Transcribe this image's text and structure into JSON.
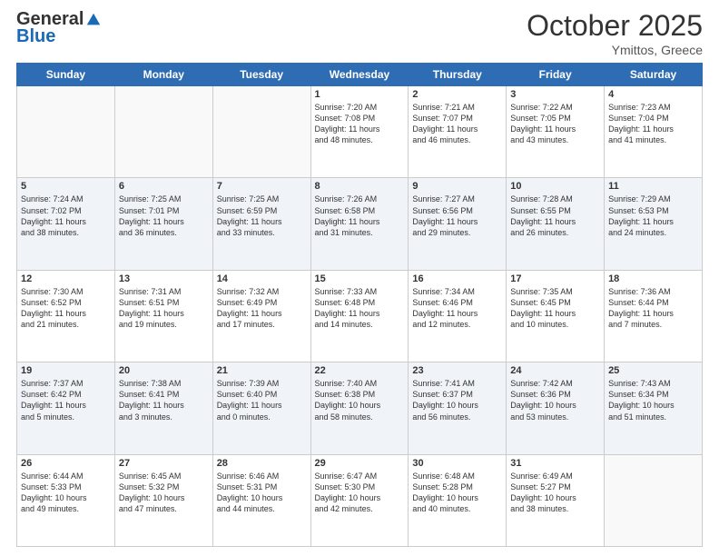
{
  "logo": {
    "general": "General",
    "blue": "Blue"
  },
  "header": {
    "month": "October 2025",
    "location": "Ymittos, Greece"
  },
  "days_of_week": [
    "Sunday",
    "Monday",
    "Tuesday",
    "Wednesday",
    "Thursday",
    "Friday",
    "Saturday"
  ],
  "weeks": [
    [
      {
        "day": "",
        "info": ""
      },
      {
        "day": "",
        "info": ""
      },
      {
        "day": "",
        "info": ""
      },
      {
        "day": "1",
        "info": "Sunrise: 7:20 AM\nSunset: 7:08 PM\nDaylight: 11 hours\nand 48 minutes."
      },
      {
        "day": "2",
        "info": "Sunrise: 7:21 AM\nSunset: 7:07 PM\nDaylight: 11 hours\nand 46 minutes."
      },
      {
        "day": "3",
        "info": "Sunrise: 7:22 AM\nSunset: 7:05 PM\nDaylight: 11 hours\nand 43 minutes."
      },
      {
        "day": "4",
        "info": "Sunrise: 7:23 AM\nSunset: 7:04 PM\nDaylight: 11 hours\nand 41 minutes."
      }
    ],
    [
      {
        "day": "5",
        "info": "Sunrise: 7:24 AM\nSunset: 7:02 PM\nDaylight: 11 hours\nand 38 minutes."
      },
      {
        "day": "6",
        "info": "Sunrise: 7:25 AM\nSunset: 7:01 PM\nDaylight: 11 hours\nand 36 minutes."
      },
      {
        "day": "7",
        "info": "Sunrise: 7:25 AM\nSunset: 6:59 PM\nDaylight: 11 hours\nand 33 minutes."
      },
      {
        "day": "8",
        "info": "Sunrise: 7:26 AM\nSunset: 6:58 PM\nDaylight: 11 hours\nand 31 minutes."
      },
      {
        "day": "9",
        "info": "Sunrise: 7:27 AM\nSunset: 6:56 PM\nDaylight: 11 hours\nand 29 minutes."
      },
      {
        "day": "10",
        "info": "Sunrise: 7:28 AM\nSunset: 6:55 PM\nDaylight: 11 hours\nand 26 minutes."
      },
      {
        "day": "11",
        "info": "Sunrise: 7:29 AM\nSunset: 6:53 PM\nDaylight: 11 hours\nand 24 minutes."
      }
    ],
    [
      {
        "day": "12",
        "info": "Sunrise: 7:30 AM\nSunset: 6:52 PM\nDaylight: 11 hours\nand 21 minutes."
      },
      {
        "day": "13",
        "info": "Sunrise: 7:31 AM\nSunset: 6:51 PM\nDaylight: 11 hours\nand 19 minutes."
      },
      {
        "day": "14",
        "info": "Sunrise: 7:32 AM\nSunset: 6:49 PM\nDaylight: 11 hours\nand 17 minutes."
      },
      {
        "day": "15",
        "info": "Sunrise: 7:33 AM\nSunset: 6:48 PM\nDaylight: 11 hours\nand 14 minutes."
      },
      {
        "day": "16",
        "info": "Sunrise: 7:34 AM\nSunset: 6:46 PM\nDaylight: 11 hours\nand 12 minutes."
      },
      {
        "day": "17",
        "info": "Sunrise: 7:35 AM\nSunset: 6:45 PM\nDaylight: 11 hours\nand 10 minutes."
      },
      {
        "day": "18",
        "info": "Sunrise: 7:36 AM\nSunset: 6:44 PM\nDaylight: 11 hours\nand 7 minutes."
      }
    ],
    [
      {
        "day": "19",
        "info": "Sunrise: 7:37 AM\nSunset: 6:42 PM\nDaylight: 11 hours\nand 5 minutes."
      },
      {
        "day": "20",
        "info": "Sunrise: 7:38 AM\nSunset: 6:41 PM\nDaylight: 11 hours\nand 3 minutes."
      },
      {
        "day": "21",
        "info": "Sunrise: 7:39 AM\nSunset: 6:40 PM\nDaylight: 11 hours\nand 0 minutes."
      },
      {
        "day": "22",
        "info": "Sunrise: 7:40 AM\nSunset: 6:38 PM\nDaylight: 10 hours\nand 58 minutes."
      },
      {
        "day": "23",
        "info": "Sunrise: 7:41 AM\nSunset: 6:37 PM\nDaylight: 10 hours\nand 56 minutes."
      },
      {
        "day": "24",
        "info": "Sunrise: 7:42 AM\nSunset: 6:36 PM\nDaylight: 10 hours\nand 53 minutes."
      },
      {
        "day": "25",
        "info": "Sunrise: 7:43 AM\nSunset: 6:34 PM\nDaylight: 10 hours\nand 51 minutes."
      }
    ],
    [
      {
        "day": "26",
        "info": "Sunrise: 6:44 AM\nSunset: 5:33 PM\nDaylight: 10 hours\nand 49 minutes."
      },
      {
        "day": "27",
        "info": "Sunrise: 6:45 AM\nSunset: 5:32 PM\nDaylight: 10 hours\nand 47 minutes."
      },
      {
        "day": "28",
        "info": "Sunrise: 6:46 AM\nSunset: 5:31 PM\nDaylight: 10 hours\nand 44 minutes."
      },
      {
        "day": "29",
        "info": "Sunrise: 6:47 AM\nSunset: 5:30 PM\nDaylight: 10 hours\nand 42 minutes."
      },
      {
        "day": "30",
        "info": "Sunrise: 6:48 AM\nSunset: 5:28 PM\nDaylight: 10 hours\nand 40 minutes."
      },
      {
        "day": "31",
        "info": "Sunrise: 6:49 AM\nSunset: 5:27 PM\nDaylight: 10 hours\nand 38 minutes."
      },
      {
        "day": "",
        "info": ""
      }
    ]
  ]
}
